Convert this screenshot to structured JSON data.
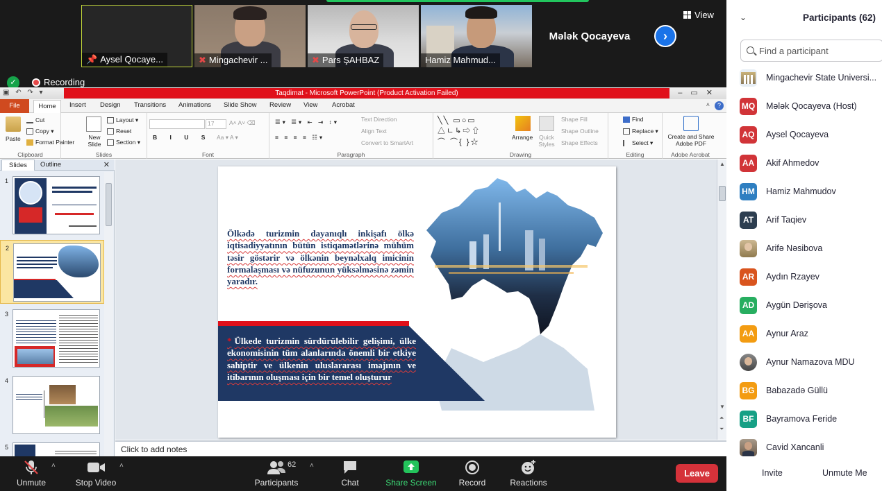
{
  "video": {
    "tiles": [
      {
        "name": "Aysel Qocaye..."
      },
      {
        "name": "Mingachevir ..."
      },
      {
        "name": "Pars ŞAHBAZ"
      },
      {
        "name": "Hamiz Mahmud..."
      }
    ],
    "speaker_name": "Mələk Qocayeva",
    "view_label": "View"
  },
  "recording_label": "Recording",
  "ppt": {
    "title": "Taqdimat  -  Microsoft PowerPoint (Product Activation Failed)",
    "tabs": [
      "File",
      "Home",
      "Insert",
      "Design",
      "Transitions",
      "Animations",
      "Slide Show",
      "Review",
      "View",
      "Acrobat"
    ],
    "ribbon": {
      "clipboard": {
        "paste": "Paste",
        "cut": "Cut",
        "copy": "Copy",
        "format_painter": "Format Painter",
        "label": "Clipboard"
      },
      "slides": {
        "new_slide": "New Slide",
        "layout": "Layout",
        "reset": "Reset",
        "section": "Section",
        "label": "Slides"
      },
      "font": {
        "size": "17",
        "label": "Font"
      },
      "paragraph": {
        "text_direction": "Text Direction",
        "align_text": "Align Text",
        "convert": "Convert to SmartArt",
        "label": "Paragraph"
      },
      "drawing": {
        "arrange": "Arrange",
        "quick_styles": "Quick Styles",
        "shape_fill": "Shape Fill",
        "shape_outline": "Shape Outline",
        "shape_effects": "Shape Effects",
        "label": "Drawing"
      },
      "editing": {
        "find": "Find",
        "replace": "Replace",
        "select": "Select",
        "label": "Editing"
      },
      "acrobat": {
        "create": "Create and Share Adobe PDF",
        "label": "Adobe Acrobat"
      }
    },
    "panel_tabs": {
      "slides": "Slides",
      "outline": "Outline"
    },
    "slide_numbers": [
      "1",
      "2",
      "3",
      "4",
      "5"
    ],
    "slide": {
      "paragraph1": "Ölkədə turizmin dayanıqlı inkişafı ölkə iqtisadiyyatının bütün istiqamətlərinə mühüm təsir göstərir və ölkənin beynəlxalq imicinin formalaşması və nüfuzunun yüksəlməsinə zəmin yaradır.",
      "bullet": "*",
      "paragraph2": "Ülkede turizmin sürdürülebilir gelişimi, ülke ekonomisinin tüm alanlarında önemli bir etkiye sahiptir ve ülkenin uluslararası imajının ve itibarının oluşması için bir temel oluşturur"
    },
    "notes_placeholder": "Click to add notes"
  },
  "toolbar": {
    "unmute": "Unmute",
    "stop_video": "Stop Video",
    "participants": "Participants",
    "participants_count": "62",
    "chat": "Chat",
    "share_screen": "Share Screen",
    "record": "Record",
    "reactions": "Reactions",
    "leave": "Leave"
  },
  "participants": {
    "title": "Participants (62)",
    "search_placeholder": "Find a participant",
    "list": [
      {
        "initials": "",
        "name": "Mingachevir State Universi...",
        "color": "#9aa0a6"
      },
      {
        "initials": "MQ",
        "name": "Mələk Qocayeva (Host)",
        "color": "#d13438"
      },
      {
        "initials": "AQ",
        "name": "Aysel Qocayeva",
        "color": "#d13438"
      },
      {
        "initials": "AA",
        "name": "Akif Ahmedov",
        "color": "#d13438"
      },
      {
        "initials": "HM",
        "name": "Hamiz Mahmudov",
        "color": "#2f7fc1"
      },
      {
        "initials": "AT",
        "name": "Arif Taqiev",
        "color": "#2d3e50"
      },
      {
        "initials": "",
        "name": "Arifə Nəsibova",
        "color": "#8f7a4e"
      },
      {
        "initials": "AR",
        "name": "Aydın Rzayev",
        "color": "#d9541e"
      },
      {
        "initials": "AD",
        "name": "Aygün Dərişova",
        "color": "#27ae60"
      },
      {
        "initials": "AA",
        "name": "Aynur Araz",
        "color": "#f39c12"
      },
      {
        "initials": "",
        "name": "Aynur Namazova MDU",
        "color": "#555555"
      },
      {
        "initials": "BG",
        "name": "Babazadə Güllü",
        "color": "#f39c12"
      },
      {
        "initials": "BF",
        "name": "Bayramova Feride",
        "color": "#16a085"
      },
      {
        "initials": "",
        "name": "Cavid Xancanli",
        "color": "#6b5a4a"
      }
    ],
    "invite": "Invite",
    "unmute_me": "Unmute Me"
  }
}
